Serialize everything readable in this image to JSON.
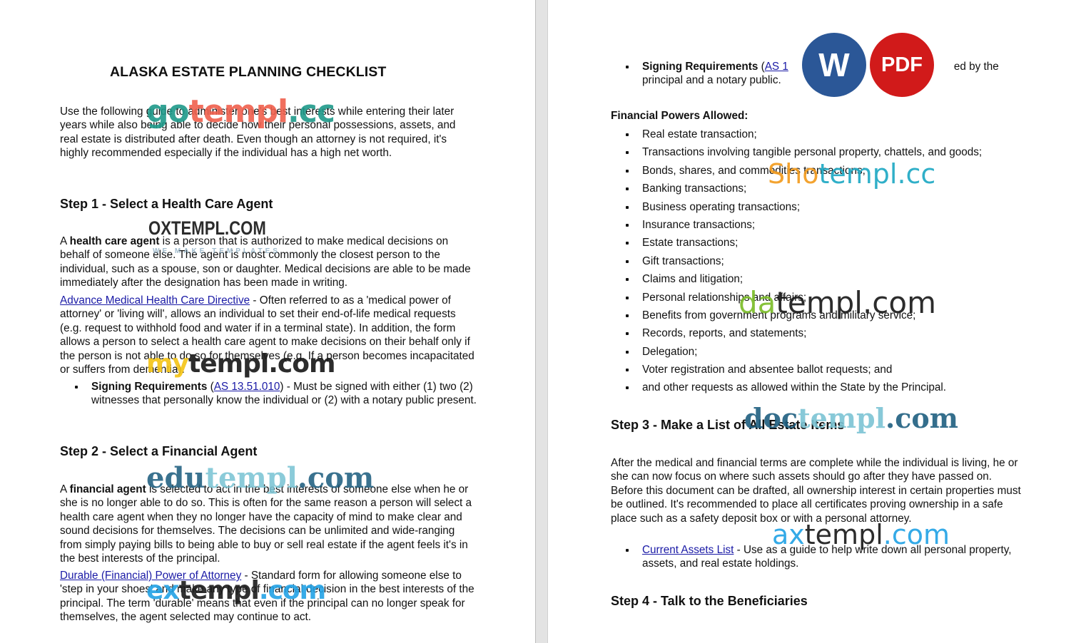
{
  "document": {
    "title": "ALASKA ESTATE PLANNING CHECKLIST",
    "intro": "Use the following guide to administer one's best interests while entering their later years while also being able to decide how their personal possessions, assets, and real estate is distributed after death. Even though an attorney is not required, it's highly recommended especially if the individual has a high net worth.",
    "step1": {
      "heading": "Step 1 - Select a Health Care Agent",
      "para_lead": "A ",
      "para_bold": "health care agent",
      "para_rest": " is a person that is authorized to make medical decisions on behalf of someone else. The agent is most commonly the closest person to the individual, such as a spouse, son or daughter. Medical decisions are able to be made immediately after the designation has been made in writing.",
      "link_text": "Advance Medical Health Care Directive",
      "link_desc": " - Often referred to as a 'medical power of attorney' or 'living will', allows an individual to set their end-of-life medical requests (e.g. request to withhold food and water if in a terminal state). In addition, the form allows a person to select a health care agent to make decisions on their behalf only if the person is not able to do so for themselves (e.g. If a person becomes incapacitated or suffers from dementia).",
      "signing_label": "Signing Requirements",
      "signing_open": " (",
      "signing_link": "AS 13.51.010",
      "signing_rest": ") - Must be signed with either (1) two (2) witnesses that personally know the individual or (2) with a notary public present."
    },
    "step2": {
      "heading": "Step 2 - Select a Financial Agent",
      "para_lead": "A ",
      "para_bold": "financial agent",
      "para_rest": " is selected to act in the best interests of someone else when he or she is no longer able to do so. This is often for the same reason a person will select a health care agent when they no longer have the capacity of mind to make clear and sound decisions for themselves. The decisions can be unlimited and wide-ranging from simply paying bills to being able to buy or sell real estate if the agent feels it's in the best interests of the principal.",
      "link_text": "Durable (Financial) Power of Attorney",
      "link_desc": " - Standard form for allowing someone else to 'step in your shoes' and make any type of financial decision in the best interests of the principal. The term 'durable' means that even if the principal can no longer speak for themselves, the agent selected may continue to act.",
      "signing_label": "Signing Requirements",
      "signing_open": " (",
      "signing_link": "AS 1",
      "signing_rest_visible": "ed by the",
      "signing_line2": "principal and a notary public."
    },
    "financial_powers": {
      "heading": "Financial Powers Allowed:",
      "items": [
        "Real estate transaction;",
        "Transactions involving tangible personal property, chattels, and goods;",
        "Bonds, shares, and commodities transactions;",
        "Banking transactions;",
        "Business operating transactions;",
        "Insurance transactions;",
        "Estate transactions;",
        "Gift transactions;",
        "Claims and litigation;",
        "Personal relationships and affairs;",
        "Benefits from government programs and military service;",
        "Records, reports, and statements;",
        "Delegation;",
        "Voter registration and absentee ballot requests; and",
        "and other requests as allowed within the State by the Principal."
      ]
    },
    "step3": {
      "heading": "Step 3 - Make a List of All Estate Items",
      "para": "After the medical and financial terms are complete while the individual is living, he or she can now focus on where such assets should go after they have passed on. Before this document can be drafted, all ownership interest in certain properties must be outlined. It's recommended to place all certificates proving ownership in a safe place such as a safety deposit box or with a personal attorney.",
      "link_text": "Current Assets List",
      "link_desc": " - Use as a guide to help write down all personal property, assets, and real estate holdings."
    },
    "step4": {
      "heading": "Step 4 - Talk to the Beneficiaries"
    }
  },
  "badges": {
    "word_label": "W",
    "word_color": "#2b5797",
    "pdf_label": "PDF",
    "pdf_color": "#d11a1a"
  },
  "watermarks": [
    {
      "id": "gotempl",
      "parts": [
        "go",
        "templ",
        ".cc"
      ],
      "colors": [
        "#1f9a8a",
        "#f0604d",
        "#1f9a8a"
      ]
    },
    {
      "id": "oxtempl",
      "parts": [
        "OXTEMPL.COM"
      ],
      "sub": "WE MAKE TEMPLATES",
      "colors": [
        "#1b1b1b"
      ]
    },
    {
      "id": "mytempl",
      "parts": [
        "my",
        "templ.com"
      ],
      "colors": [
        "#f5c518",
        "#1b1b1b"
      ]
    },
    {
      "id": "edutempl",
      "parts": [
        "edu",
        "templ",
        ".com"
      ],
      "colors": [
        "#1f5f80",
        "#7cc4d4",
        "#1f5f80"
      ]
    },
    {
      "id": "extempl",
      "parts": [
        "ex",
        "templ",
        ".com"
      ],
      "colors": [
        "#23a3e6",
        "#1b1b1b",
        "#23a3e6"
      ]
    },
    {
      "id": "shotempl",
      "parts": [
        "Sho",
        "templ.cc"
      ],
      "colors": [
        "#f39c1f",
        "#1fa9c4"
      ]
    },
    {
      "id": "datempl",
      "parts": [
        "da",
        "templ.com"
      ],
      "colors": [
        "#7cbd2a",
        "#1b1b1b"
      ]
    },
    {
      "id": "doctempl",
      "parts": [
        "doc",
        "templ",
        ".com"
      ],
      "colors": [
        "#1f5f80",
        "#7cc4d4",
        "#1f5f80"
      ]
    },
    {
      "id": "axtempl",
      "parts": [
        "ax",
        "templ",
        ".com"
      ],
      "colors": [
        "#23a3e6",
        "#1b1b1b",
        "#23a3e6"
      ]
    }
  ]
}
